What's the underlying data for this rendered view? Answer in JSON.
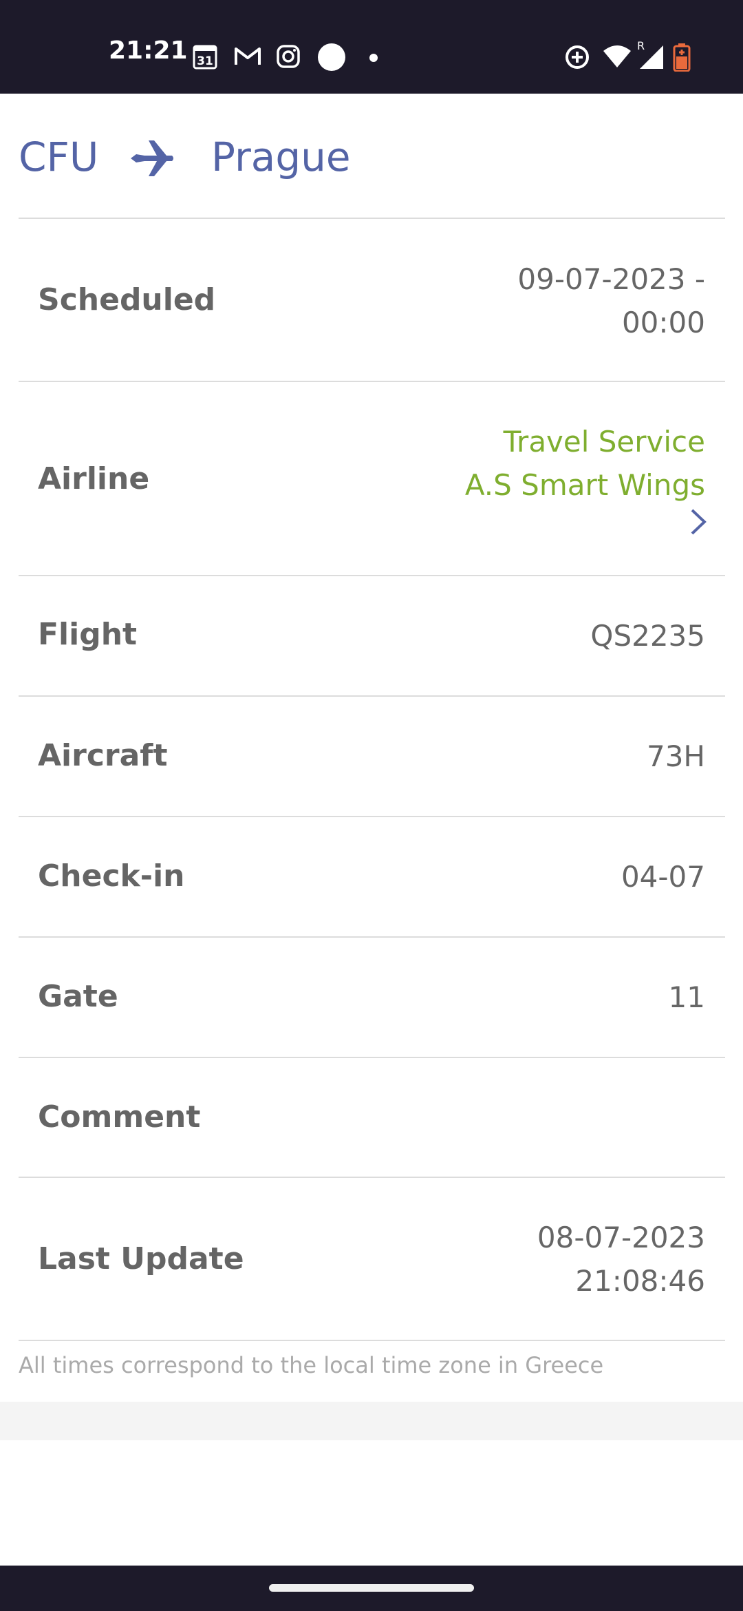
{
  "status_bar": {
    "time": "21:21",
    "calendar_date": "31",
    "icons": [
      "calendar-icon",
      "gmail-icon",
      "instagram-icon",
      "circle-icon",
      "dot-icon",
      "data-saver-icon",
      "wifi-icon",
      "signal-icon",
      "battery-icon"
    ],
    "signal_roaming": "R"
  },
  "route": {
    "origin": "CFU",
    "destination": "Prague",
    "icon": "airplane-icon",
    "color": "#5464a6"
  },
  "details": {
    "scheduled": {
      "label": "Scheduled",
      "value_line1": "09-07-2023 -",
      "value_line2": "00:00"
    },
    "airline": {
      "label": "Airline",
      "value_line1": "Travel Service",
      "value_line2": "A.S Smart Wings",
      "color": "#7fae2f"
    },
    "flight": {
      "label": "Flight",
      "value": "QS2235"
    },
    "aircraft": {
      "label": "Aircraft",
      "value": "73H"
    },
    "checkin": {
      "label": "Check-in",
      "value": "04-07"
    },
    "gate": {
      "label": "Gate",
      "value": "11"
    },
    "comment": {
      "label": "Comment",
      "value": ""
    },
    "last_update": {
      "label": "Last Update",
      "value_line1": "08-07-2023",
      "value_line2": "21:08:46"
    }
  },
  "footnote": "All times correspond to the local time zone in Greece"
}
